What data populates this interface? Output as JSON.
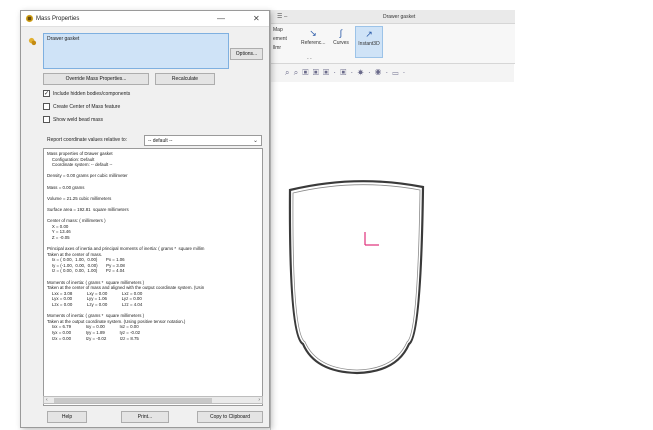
{
  "cad": {
    "title": "Drawer gasket",
    "quick_access": "☰ –",
    "ribbon_left": [
      "Map",
      "ement",
      "llmr"
    ],
    "ribbon_buttons": [
      {
        "label": "Referenc...",
        "icon": "reference-geometry-icon",
        "glyph": "↘"
      },
      {
        "label": "Curves",
        "icon": "curves-icon",
        "glyph": "∫"
      },
      {
        "label": "Instant3D",
        "icon": "instant3d-icon",
        "glyph": "↗",
        "active": true
      }
    ],
    "ribbon_dashes": "- -",
    "hud_icons": "⌕ ⌕ ▣ ▣ ▣ · ▣ · ☀ · ◉ · ▭ ·",
    "colors": {
      "outline": "#3a3a3a",
      "origin": "#e0307a"
    }
  },
  "dialog": {
    "title": "Mass Properties",
    "window_controls": {
      "minimize": "—",
      "close": "✕"
    },
    "selection": "Drawer gasket",
    "options_label": "Options...",
    "override_label": "Override Mass Properties...",
    "recalculate_label": "Recalculate",
    "checkboxes": [
      {
        "label": "Include hidden bodies/components",
        "checked": true
      },
      {
        "label": "Create Center of Mass feature",
        "checked": false
      },
      {
        "label": "Show weld bead mass",
        "checked": false
      }
    ],
    "report_label": "Report coordinate values relative to:",
    "report_value": "-- default --",
    "results_text": "Mass properties of Drawer gasket\n    Configuration: Default\n    Coordinate system: -- default --\n\nDensity = 0.00 grams per cubic millimeter\n\nMass = 0.00 grams\n\nVolume = 21.25 cubic millimeters\n\nSurface area = 192.81  square millimeters\n\nCenter of mass: ( millimeters )\n    X = 0.00\n    Y = 13.46\n    Z = -0.05\n\nPrincipal axes of inertia and principal moments of inertia: ( grams *  square millim\nTaken at the center of mass.\n    Ix = ( 0.00,  1.00,  0.00)       Px = 1.06\n    Iy = (-1.00,  0.00,  0.00)       Py = 3.08\n    Iz = ( 0.00,  0.00,  1.00)       Pz = 4.04\n\nMoments of inertia: ( grams *  square millimeters )\nTaken at the center of mass and aligned with the output coordinate system. (Usin\n    Lxx = 3.08            Lxy = 0.00            Lxz = 0.00\n    Lyx = 0.00            Lyy = 1.06            Lyz = 0.00\n    Lzx = 0.00            Lzy = 0.00            Lzz = 4.04\n\nMoments of inertia: ( grams *  square millimeters )\nTaken at the output coordinate system. (Using positive tensor notation.)\n    Ixx = 6.79            Ixy = 0.00            Ixz = 0.00\n    Iyx = 0.00            Iyy = 1.89            Iyz = -0.02\n    Izx = 0.00            Izy = -0.02           Izz = 8.75",
    "help_label": "Help",
    "print_label": "Print...",
    "copy_label": "Copy to Clipboard"
  }
}
